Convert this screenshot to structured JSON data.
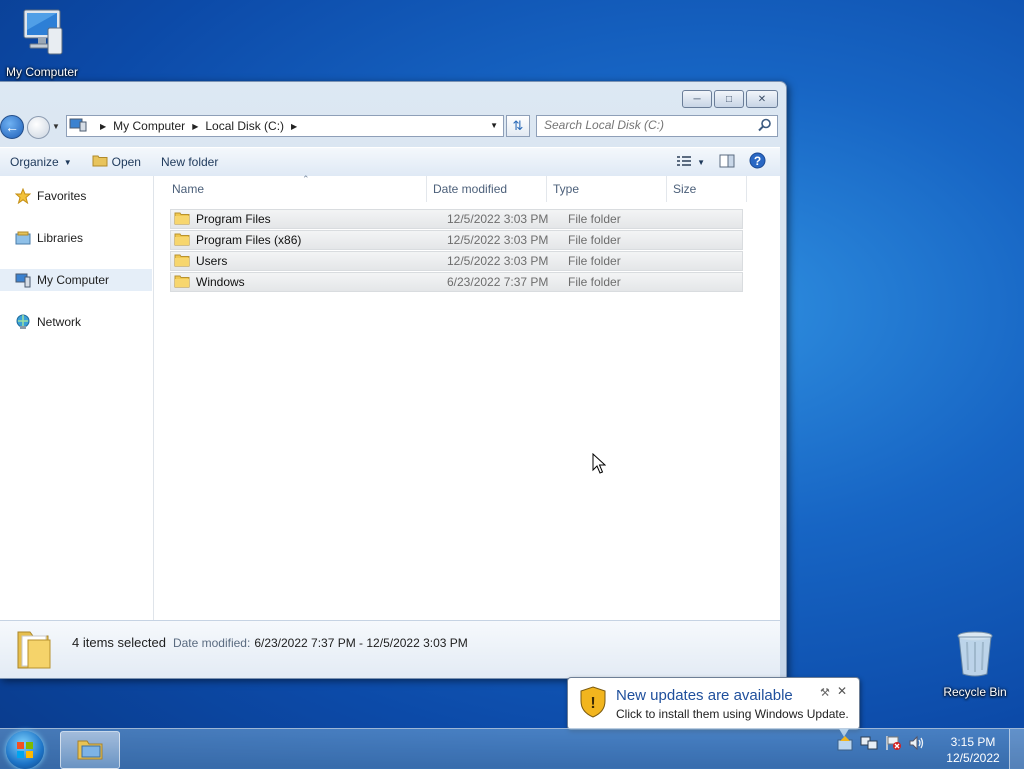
{
  "desktop": {
    "my_computer_label": "My Computer",
    "recycle_bin_label": "Recycle Bin"
  },
  "window": {
    "address": {
      "crumbs": [
        "My Computer",
        "Local Disk (C:)"
      ]
    },
    "search": {
      "placeholder": "Search Local Disk (C:)"
    },
    "toolbar": {
      "organize": "Organize",
      "open": "Open",
      "new_folder": "New folder"
    },
    "nav": {
      "favorites": "Favorites",
      "libraries": "Libraries",
      "my_computer": "My Computer",
      "network": "Network"
    },
    "columns": {
      "name": "Name",
      "date_modified": "Date modified",
      "type": "Type",
      "size": "Size"
    },
    "files": [
      {
        "name": "Program Files",
        "date": "12/5/2022 3:03 PM",
        "type": "File folder"
      },
      {
        "name": "Program Files (x86)",
        "date": "12/5/2022 3:03 PM",
        "type": "File folder"
      },
      {
        "name": "Users",
        "date": "12/5/2022 3:03 PM",
        "type": "File folder"
      },
      {
        "name": "Windows",
        "date": "6/23/2022 7:37 PM",
        "type": "File folder"
      }
    ],
    "details": {
      "count": "4 items selected",
      "date_label": "Date modified:",
      "date_value": "6/23/2022 7:37 PM - 12/5/2022 3:03 PM"
    }
  },
  "balloon": {
    "title": "New updates are available",
    "body": "Click to install them using Windows Update."
  },
  "clock": {
    "time": "3:15 PM",
    "date": "12/5/2022"
  },
  "colors": {
    "selection_bg": "#e5eef8",
    "balloon_title": "#1f4f9c",
    "desktop": "#1765c4"
  }
}
